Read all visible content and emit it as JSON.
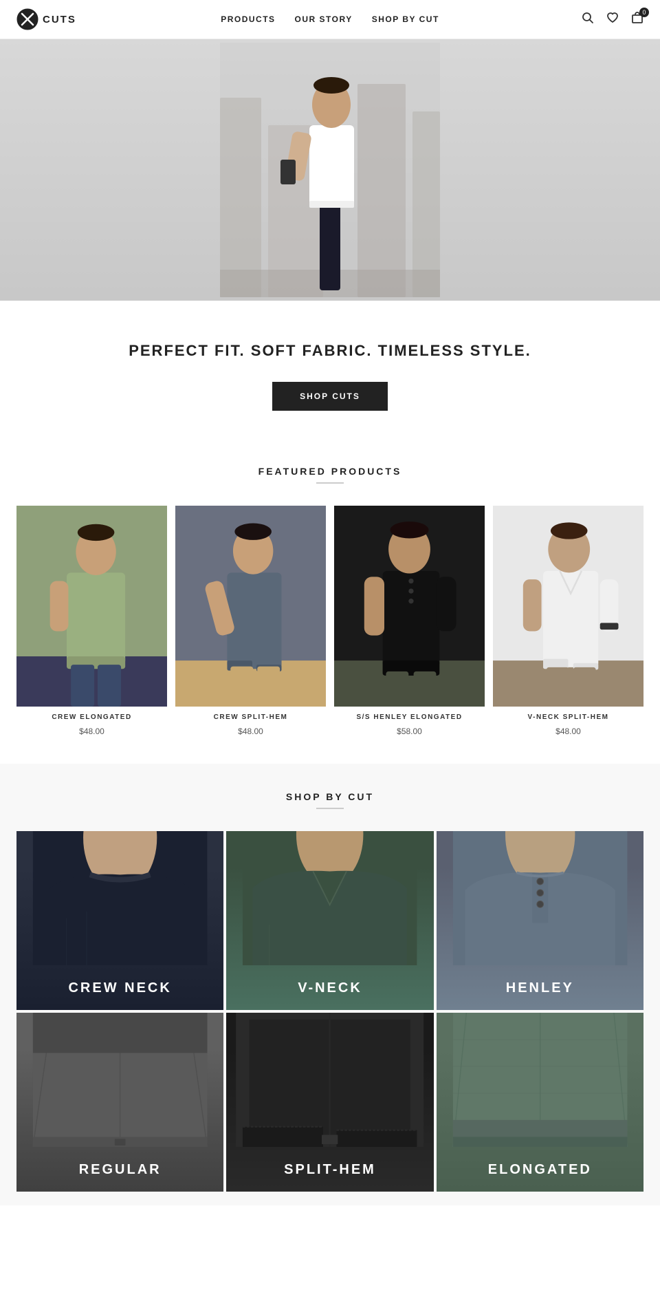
{
  "brand": {
    "name": "CUTS",
    "logo_alt": "Cuts brand logo"
  },
  "nav": {
    "items": [
      {
        "label": "PRODUCTS",
        "href": "#"
      },
      {
        "label": "OUR STORY",
        "href": "#"
      },
      {
        "label": "SHOP BY CUT",
        "href": "#"
      }
    ]
  },
  "header_icons": {
    "search": "🔍",
    "wishlist": "♡",
    "cart": "□",
    "cart_count": "0"
  },
  "tagline": {
    "text": "PERFECT FIT. SOFT FABRIC. TIMELESS STYLE.",
    "cta_label": "SHOP CUTS"
  },
  "featured": {
    "title": "FEATURED PRODUCTS",
    "products": [
      {
        "name": "CREW ELONGATED",
        "price": "$48.00"
      },
      {
        "name": "CREW SPLIT-HEM",
        "price": "$48.00"
      },
      {
        "name": "S/S HENLEY ELONGATED",
        "price": "$58.00"
      },
      {
        "name": "V-NECK SPLIT-HEM",
        "price": "$48.00"
      }
    ]
  },
  "shop_by_cut": {
    "title": "SHOP BY CUT",
    "cuts": [
      {
        "label": "CREW NECK",
        "css_class": "cut-crew-neck"
      },
      {
        "label": "V-NECK",
        "css_class": "cut-v-neck"
      },
      {
        "label": "HENLEY",
        "css_class": "cut-henley"
      },
      {
        "label": "REGULAR",
        "css_class": "cut-regular"
      },
      {
        "label": "SPLIT-HEM",
        "css_class": "cut-split-hem"
      },
      {
        "label": "ELONGATED",
        "css_class": "cut-elongated"
      }
    ]
  },
  "colors": {
    "primary": "#222222",
    "background": "#ffffff",
    "accent": "#cccccc"
  }
}
